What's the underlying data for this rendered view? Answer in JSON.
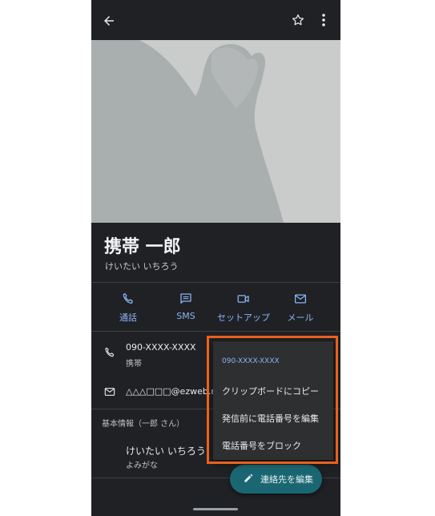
{
  "contact": {
    "name": "携帯 一郎",
    "reading": "けいたい いちろう"
  },
  "actions": [
    {
      "label": "通話",
      "icon": "phone-icon"
    },
    {
      "label": "SMS",
      "icon": "message-icon"
    },
    {
      "label": "セットアップ",
      "icon": "video-icon"
    },
    {
      "label": "メール",
      "icon": "mail-icon"
    }
  ],
  "phone": {
    "number": "090-XXXX-XXXX",
    "type": "携帯"
  },
  "email": {
    "address": "△△△□□□@ezweb.ne"
  },
  "basic_info": {
    "title": "基本情報（一郎 さん）",
    "value": "けいたい いちろう",
    "label": "よみがな"
  },
  "fab": {
    "label": "連絡先を編集",
    "icon": "pencil-icon"
  },
  "context_menu": {
    "items": [
      {
        "label": "090-XXXX-XXXX"
      },
      {
        "label": "クリップボードにコピー"
      },
      {
        "label": "発信前に電話番号を編集"
      },
      {
        "label": "電話番号をブロック"
      }
    ]
  },
  "colors": {
    "accent": "#8ab4f8",
    "background": "#202124",
    "fab": "#1a6773",
    "highlight": "#e8621f"
  }
}
